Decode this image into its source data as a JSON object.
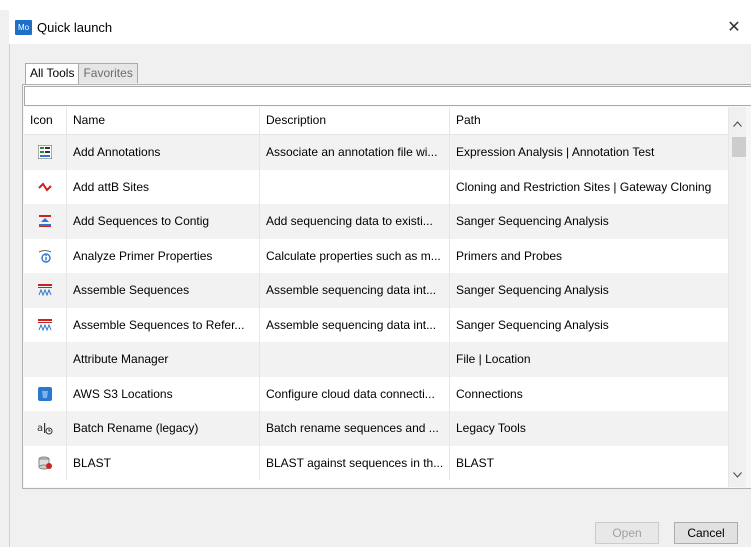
{
  "window": {
    "title": "Quick launch",
    "app_icon_text": "Mo"
  },
  "tabs": [
    {
      "label": "All Tools",
      "active": true
    },
    {
      "label": "Favorites",
      "active": false
    }
  ],
  "search": {
    "value": "",
    "placeholder": ""
  },
  "table": {
    "headers": [
      "Icon",
      "Name",
      "Description",
      "Path"
    ],
    "rows": [
      {
        "icon": "annotation-icon",
        "name": "Add Annotations",
        "description": "Associate an annotation file wi...",
        "path": "Expression Analysis | Annotation Test"
      },
      {
        "icon": "attb-sites-icon",
        "name": "Add attB Sites",
        "description": "",
        "path": "Cloning and Restriction Sites | Gateway Cloning"
      },
      {
        "icon": "contig-add-icon",
        "name": "Add Sequences to Contig",
        "description": "Add sequencing data to existi...",
        "path": "Sanger Sequencing Analysis"
      },
      {
        "icon": "primer-properties-icon",
        "name": "Analyze Primer Properties",
        "description": "Calculate properties such as m...",
        "path": "Primers and Probes"
      },
      {
        "icon": "assemble-icon",
        "name": "Assemble Sequences",
        "description": "Assemble sequencing data int...",
        "path": "Sanger Sequencing Analysis"
      },
      {
        "icon": "assemble-reference-icon",
        "name": "Assemble Sequences to Refer...",
        "description": "Assemble sequencing data int...",
        "path": "Sanger Sequencing Analysis"
      },
      {
        "icon": "",
        "name": "Attribute Manager",
        "description": "",
        "path": "File | Location"
      },
      {
        "icon": "aws-s3-icon",
        "name": "AWS S3 Locations",
        "description": "Configure cloud data connecti...",
        "path": "Connections"
      },
      {
        "icon": "batch-rename-icon",
        "name": "Batch Rename (legacy)",
        "description": "Batch rename sequences and ...",
        "path": "Legacy Tools"
      },
      {
        "icon": "blast-icon",
        "name": "BLAST",
        "description": "BLAST against sequences in th...",
        "path": "BLAST"
      }
    ]
  },
  "buttons": {
    "open": "Open",
    "cancel": "Cancel"
  },
  "colors": {
    "app_icon": "#1f6fc9",
    "accent_red": "#cc2222",
    "accent_blue": "#2b78d0"
  }
}
